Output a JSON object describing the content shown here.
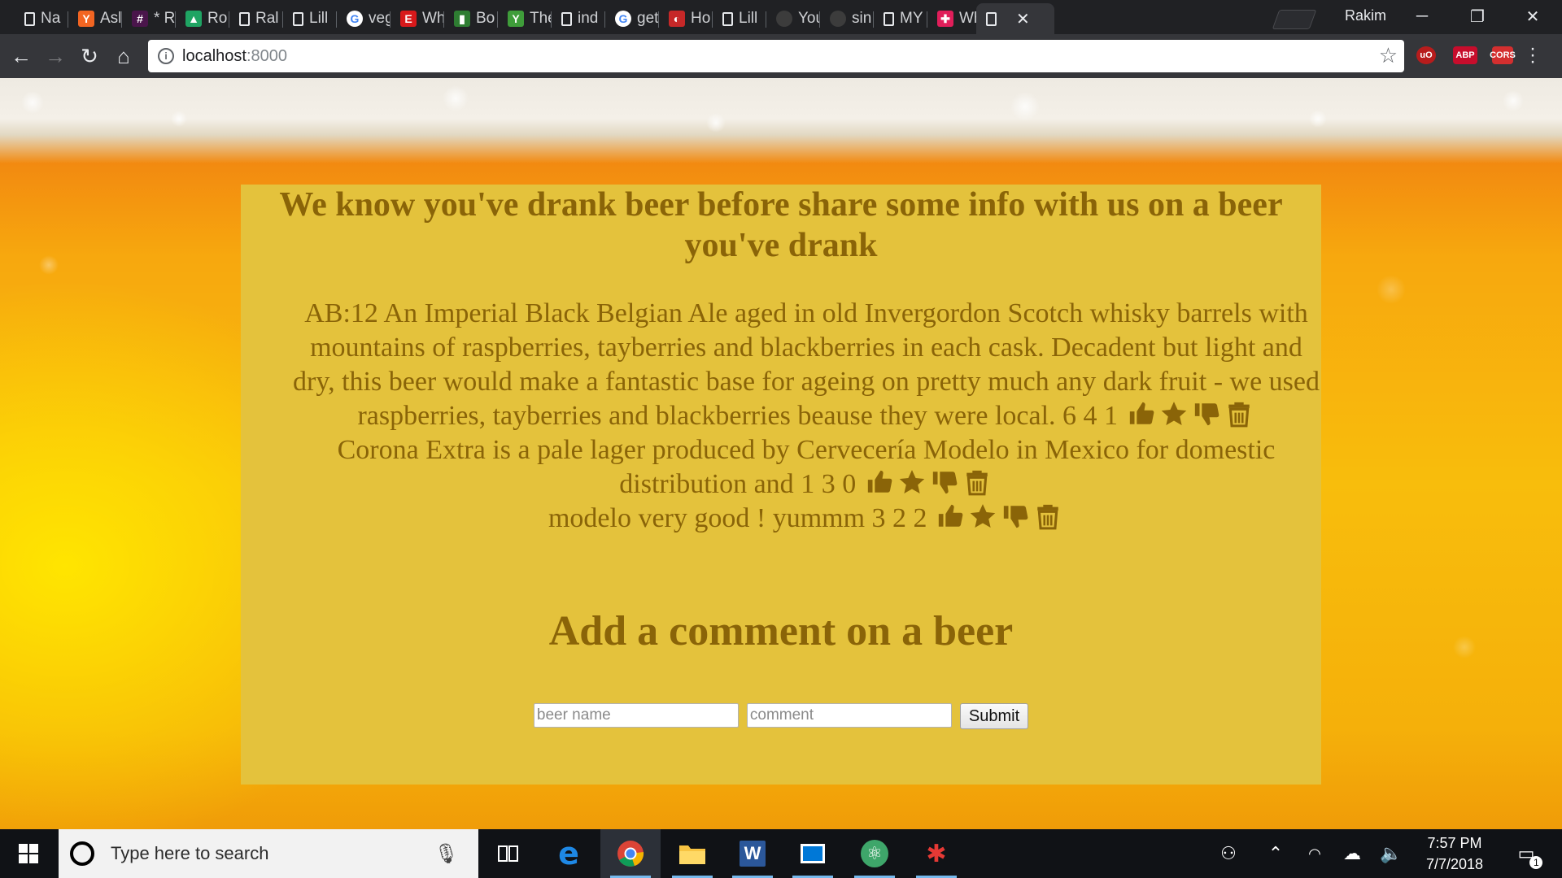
{
  "browser": {
    "tabs": [
      {
        "title": "Na",
        "favicon": "document-icon"
      },
      {
        "title": "Asl",
        "favicon": "ycombinator-icon",
        "favicon_glyph": "Y",
        "favicon_color": "#f26522"
      },
      {
        "title": "* R",
        "favicon": "slack-hash-icon",
        "favicon_glyph": "#",
        "favicon_color": "#4a154b"
      },
      {
        "title": "Ro",
        "favicon": "google-drive-icon",
        "favicon_glyph": "▲",
        "favicon_color": "#1fa463"
      },
      {
        "title": "Ral",
        "favicon": "document-icon"
      },
      {
        "title": "Lill",
        "favicon": "document-icon"
      },
      {
        "title": "veg",
        "favicon": "google-icon",
        "favicon_glyph": "G"
      },
      {
        "title": "Wh",
        "favicon": "e-brand-icon",
        "favicon_glyph": "E",
        "favicon_color": "#d8191b"
      },
      {
        "title": "Bo",
        "favicon": "bottle-icon",
        "favicon_glyph": "▮",
        "favicon_color": "#2e7d32"
      },
      {
        "title": "The",
        "favicon": "y-brand-icon",
        "favicon_glyph": "Y",
        "favicon_color": "#3f9d3a"
      },
      {
        "title": "ind",
        "favicon": "document-icon"
      },
      {
        "title": "get",
        "favicon": "google-icon",
        "favicon_glyph": "G"
      },
      {
        "title": "Ho",
        "favicon": "baseball-icon",
        "favicon_glyph": "◐",
        "favicon_color": "#c62828"
      },
      {
        "title": "Lill",
        "favicon": "document-icon"
      },
      {
        "title": "You",
        "favicon": "github-icon"
      },
      {
        "title": "sin",
        "favicon": "github-icon"
      },
      {
        "title": "MY",
        "favicon": "document-icon"
      },
      {
        "title": "Wh",
        "favicon": "slack-icon",
        "favicon_glyph": "✚",
        "favicon_color": "#e01e5a"
      },
      {
        "title": "",
        "favicon": "document-icon",
        "active": true
      }
    ],
    "profile_name": "Rakim",
    "url_host": "localhost",
    "url_port": ":8000",
    "extensions": [
      {
        "label": "uO",
        "color": "#b71c1c"
      },
      {
        "label": "ABP",
        "color": "#c70d2c"
      },
      {
        "label": "CORS",
        "color": "#d32f2f"
      }
    ]
  },
  "page": {
    "heading": "We know you've drank beer before share some info with us on a beer you've drank",
    "beers": [
      {
        "text": "AB:12 An Imperial Black Belgian Ale aged in old Invergordon Scotch whisky barrels with mountains of raspberries, tayberries and blackberries in each cask. Decadent but light and dry, this beer would make a fantastic base for ageing on pretty much any dark fruit - we used raspberries, tayberries and blackberries beause they were local.",
        "counts": "6 4 1"
      },
      {
        "text": "Corona Extra is a pale lager produced by Cervecería Modelo in Mexico for domestic distribution and",
        "counts": "1 3 0"
      },
      {
        "text": "modelo very good ! yummm",
        "counts": "3 2 2"
      }
    ],
    "form_heading": "Add a comment on a beer",
    "form": {
      "beer_name_placeholder": "beer name",
      "comment_placeholder": "comment",
      "submit_label": "Submit"
    }
  },
  "taskbar": {
    "search_placeholder": "Type here to search",
    "time": "7:57 PM",
    "date": "7/7/2018",
    "notification_count": "1"
  }
}
